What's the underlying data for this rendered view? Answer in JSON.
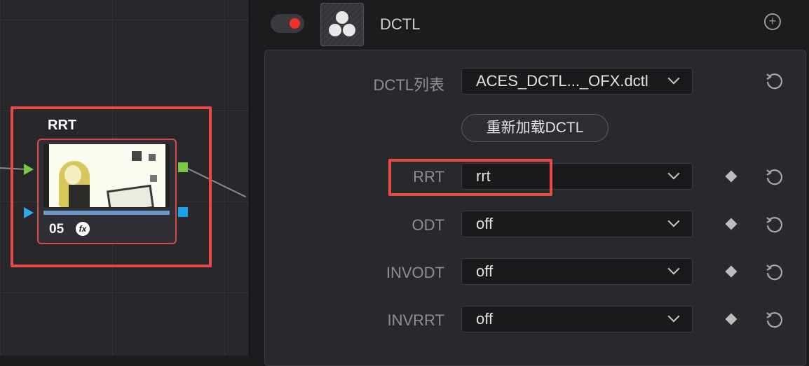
{
  "node": {
    "title": "RRT",
    "number": "05",
    "fx_label": "fx",
    "input_port_colors": [
      "#7ac943",
      "#2fa8e8"
    ],
    "output_port_colors": [
      "#7ac943",
      "#1aa3e8"
    ]
  },
  "inspector": {
    "plugin_name": "DCTL",
    "plugin_icon": "resolve-logo-icon",
    "enabled": true,
    "dctl_list": {
      "label": "DCTL列表",
      "value": "ACES_DCTL..._OFX.dctl"
    },
    "reload_label": "重新加载DCTL",
    "params": [
      {
        "label": "RRT",
        "value": "rrt"
      },
      {
        "label": "ODT",
        "value": "off"
      },
      {
        "label": "INVODT",
        "value": "off"
      },
      {
        "label": "INVRRT",
        "value": "off"
      }
    ]
  },
  "colors": {
    "highlight": "#e64b43",
    "toggle_on": "#f0302a"
  }
}
